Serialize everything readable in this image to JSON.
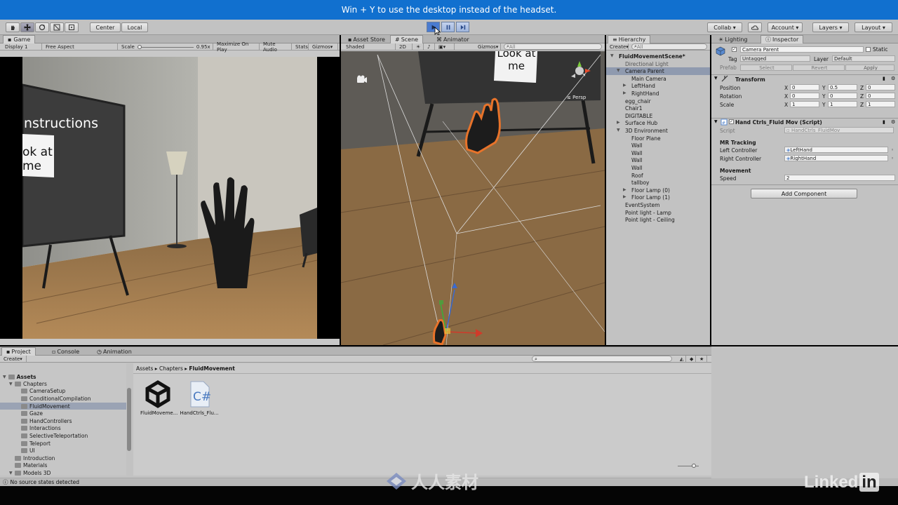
{
  "banner": {
    "text": "Win + Y to use the desktop instead of the headset."
  },
  "toolbar": {
    "pivot": "Center",
    "space": "Local",
    "collab": "Collab",
    "account": "Account",
    "layers": "Layers",
    "layout": "Layout"
  },
  "game": {
    "tab": "Game",
    "display": "Display 1",
    "aspect": "Free Aspect",
    "scale_label": "Scale",
    "scale_value": "0.95",
    "maximize": "Maximize On Play",
    "mute": "Mute Audio",
    "stats": "Stats",
    "gizmos": "Gizmos",
    "board_title": "nstructions",
    "card_line1": "ok at",
    "card_line2": "me"
  },
  "scene": {
    "tabs": [
      "Asset Store",
      "Scene",
      "Animator"
    ],
    "shaded": "Shaded",
    "mode2d": "2D",
    "gizmos": "Gizmos",
    "search": "All",
    "persp": "Persp",
    "card_line1": "Look at",
    "card_line2": "me"
  },
  "hierarchy": {
    "tab": "Hierarchy",
    "create": "Create",
    "search": "All",
    "items": [
      {
        "label": "FluidMovementScene*",
        "depth": 0,
        "bold": true,
        "expander": "open"
      },
      {
        "label": "Directional Light",
        "depth": 1,
        "dim": true
      },
      {
        "label": "Camera Parent",
        "depth": 1,
        "selected": true,
        "expander": "open"
      },
      {
        "label": "Main Camera",
        "depth": 2
      },
      {
        "label": "LeftHand",
        "depth": 2,
        "expander": "closed"
      },
      {
        "label": "RightHand",
        "depth": 2,
        "expander": "closed"
      },
      {
        "label": "egg_chair",
        "depth": 1
      },
      {
        "label": "Chair1",
        "depth": 1
      },
      {
        "label": "DIGITABLE",
        "depth": 1
      },
      {
        "label": "Surface Hub",
        "depth": 1,
        "expander": "closed"
      },
      {
        "label": "3D Environment",
        "depth": 1,
        "expander": "open"
      },
      {
        "label": "Floor Plane",
        "depth": 2
      },
      {
        "label": "Wall",
        "depth": 2
      },
      {
        "label": "Wall",
        "depth": 2
      },
      {
        "label": "Wall",
        "depth": 2
      },
      {
        "label": "Wall",
        "depth": 2
      },
      {
        "label": "Roof",
        "depth": 2
      },
      {
        "label": "tallboy",
        "depth": 2
      },
      {
        "label": "Floor Lamp (0)",
        "depth": 2,
        "expander": "closed"
      },
      {
        "label": "Floor Lamp (1)",
        "depth": 2,
        "expander": "closed"
      },
      {
        "label": "EventSystem",
        "depth": 1
      },
      {
        "label": "Point light - Lamp",
        "depth": 1
      },
      {
        "label": "Point light - Ceiling",
        "depth": 1
      }
    ]
  },
  "inspector": {
    "tabs": [
      "Lighting",
      "Inspector"
    ],
    "object_name": "Camera Parent",
    "static": "Static",
    "tag_label": "Tag",
    "tag_value": "Untagged",
    "layer_label": "Layer",
    "layer_value": "Default",
    "prefab_label": "Prefab",
    "prefab_select": "Select",
    "prefab_revert": "Revert",
    "prefab_apply": "Apply",
    "transform": {
      "title": "Transform",
      "rows": [
        {
          "label": "Position",
          "x": "0",
          "y": "0.5",
          "z": "0"
        },
        {
          "label": "Rotation",
          "x": "0",
          "y": "0",
          "z": "0"
        },
        {
          "label": "Scale",
          "x": "1",
          "y": "1",
          "z": "1"
        }
      ]
    },
    "script_component": {
      "title": "Hand Ctrls_Fluid Mov (Script)",
      "script_label": "Script",
      "script_value": "HandCtrls_FluidMov",
      "section_tracking": "MR Tracking",
      "left_label": "Left Controller",
      "left_value": "LeftHand",
      "right_label": "Right Controller",
      "right_value": "RightHand",
      "section_movement": "Movement",
      "speed_label": "Speed",
      "speed_value": "2"
    },
    "add_component": "Add Component"
  },
  "project": {
    "tabs": [
      "Project",
      "Console",
      "Animation"
    ],
    "create": "Create",
    "root": "Assets",
    "tree": [
      {
        "label": "Chapters",
        "depth": 1,
        "expander": "open"
      },
      {
        "label": "CameraSetup",
        "depth": 2
      },
      {
        "label": "ConditionalCompilation",
        "depth": 2
      },
      {
        "label": "FluidMovement",
        "depth": 2,
        "selected": true
      },
      {
        "label": "Gaze",
        "depth": 2
      },
      {
        "label": "HandControllers",
        "depth": 2
      },
      {
        "label": "Interactions",
        "depth": 2
      },
      {
        "label": "SelectiveTeleportation",
        "depth": 2
      },
      {
        "label": "Teleport",
        "depth": 2
      },
      {
        "label": "UI",
        "depth": 2
      },
      {
        "label": "Introduction",
        "depth": 1
      },
      {
        "label": "Materials",
        "depth": 1
      },
      {
        "label": "Models 3D",
        "depth": 1,
        "expander": "open"
      }
    ],
    "breadcrumb": [
      "Assets",
      "Chapters",
      "FluidMovement"
    ],
    "assets": [
      {
        "label": "FluidMoveme...",
        "icon": "unity-scene-icon"
      },
      {
        "label": "HandCtrls_Flu...",
        "icon": "csharp-script-icon"
      }
    ]
  },
  "status": {
    "text": "No source states detected"
  },
  "overlay": {
    "watermark": "人人素材",
    "brand": "Linked",
    "brand_in": "in"
  },
  "colors": {
    "banner": "#1170cf",
    "selection": "#8f9aaf",
    "play_active": "#4a7bd0",
    "highlight_orange": "#e8732a"
  }
}
